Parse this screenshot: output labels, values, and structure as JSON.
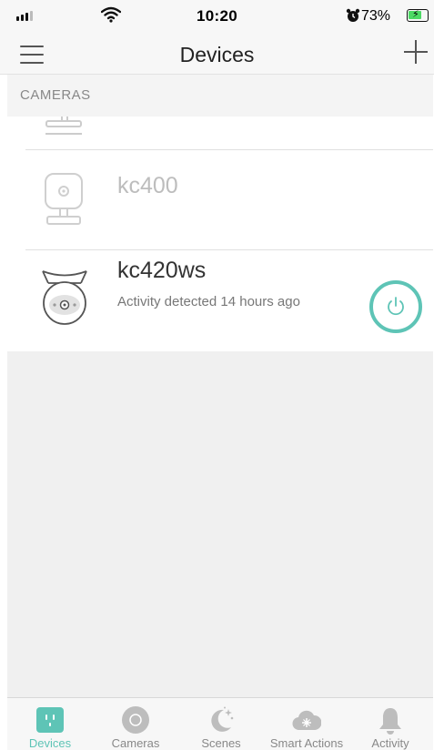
{
  "status_bar": {
    "time": "10:20",
    "battery_percent": "73%",
    "battery_level": 0.73,
    "icons": [
      "signal-icon",
      "wifi-icon",
      "alarm-icon",
      "battery-charging-icon"
    ]
  },
  "header": {
    "title": "Devices",
    "menu_icon": "hamburger-menu-icon",
    "add_icon": "plus-icon"
  },
  "section": {
    "label": "CAMERAS"
  },
  "devices": [
    {
      "name": "kc400",
      "status": "",
      "icon": "indoor-camera-icon",
      "offline": true
    },
    {
      "name": "kc420ws",
      "status": "Activity detected 14 hours ago",
      "icon": "outdoor-camera-icon",
      "offline": false,
      "power_icon": "power-icon"
    }
  ],
  "tabs": [
    {
      "label": "Devices",
      "icon": "devices-icon",
      "active": true
    },
    {
      "label": "Cameras",
      "icon": "camera-lens-icon",
      "active": false
    },
    {
      "label": "Scenes",
      "icon": "moon-stars-icon",
      "active": false
    },
    {
      "label": "Smart Actions",
      "icon": "cloud-sparkle-icon",
      "active": false
    },
    {
      "label": "Activity",
      "icon": "bell-icon",
      "active": false
    }
  ],
  "colors": {
    "accent": "#5ec4b6",
    "tab_inactive": "#bdbdbd",
    "background": "#f0f0f0"
  }
}
